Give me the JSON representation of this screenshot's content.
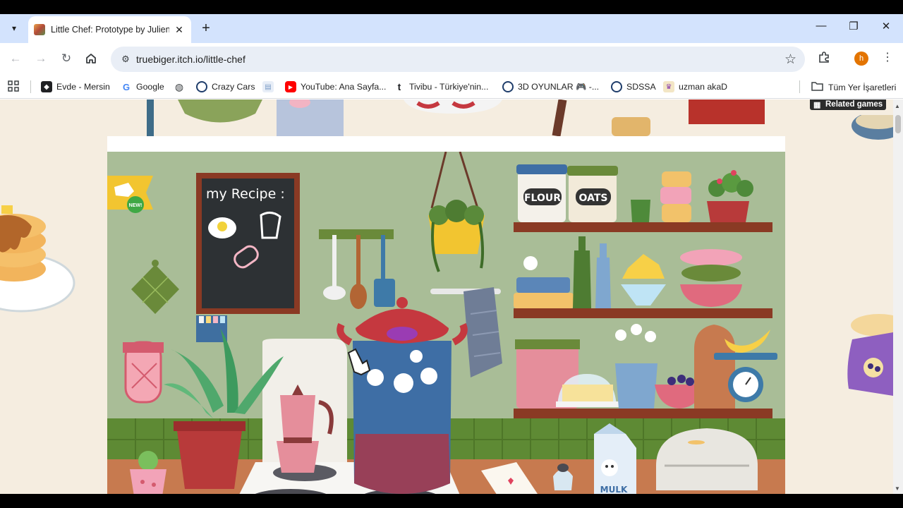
{
  "browser": {
    "tab": {
      "title": "Little Chef: Prototype by Julien",
      "close_label": "✕"
    },
    "newtab_label": "+",
    "window_controls": {
      "minimize": "—",
      "restore": "❐",
      "close": "✕"
    },
    "url": "truebiger.itch.io/little-chef",
    "avatar_letter": "h"
  },
  "bookmarks": [
    {
      "label": "Evde - Mersin",
      "icon": "site-icon",
      "color": "#202124"
    },
    {
      "label": "Google",
      "icon": "google-icon",
      "color": "#4285f4"
    },
    {
      "label": "",
      "icon": "globe-icon",
      "color": "#5f6368"
    },
    {
      "label": "Crazy Cars",
      "icon": "site-icon",
      "color": "#1a73e8"
    },
    {
      "label": "",
      "icon": "doc-icon",
      "color": "#7a9cc6"
    },
    {
      "label": "YouTube: Ana Sayfa...",
      "icon": "youtube-icon",
      "color": "#ff0000"
    },
    {
      "label": "Tivibu - Türkiye'nin...",
      "icon": "tivibu-icon",
      "color": "#202124"
    },
    {
      "label": "3D OYUNLAR 🎮 -...",
      "icon": "site-icon",
      "color": "#1a73e8"
    },
    {
      "label": "SDSSA",
      "icon": "site-icon",
      "color": "#1a73e8"
    },
    {
      "label": "uzman akaD",
      "icon": "site-icon",
      "color": "#8e44ad"
    }
  ],
  "bookmarks_folder": "Tüm Yer İşaretleri",
  "page": {
    "related_games": "Related games",
    "game": {
      "chalkboard_title": "my Recipe :",
      "jar_labels": [
        "FLOUR",
        "OATS"
      ],
      "new_badge": "NEW!",
      "milk_label": "MULK"
    }
  }
}
